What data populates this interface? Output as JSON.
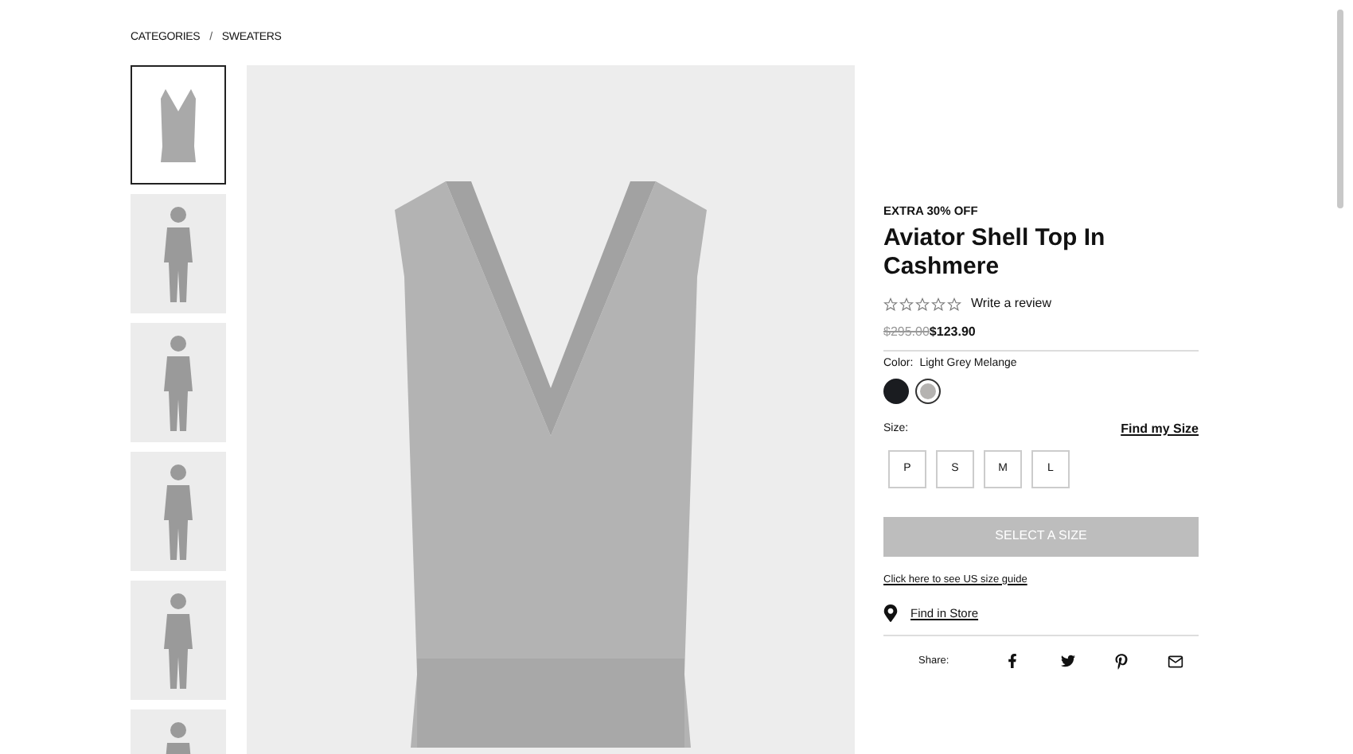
{
  "breadcrumb": [
    {
      "label": "CATEGORIES"
    },
    {
      "label": "SWEATERS"
    }
  ],
  "breadcrumb_separator": "/",
  "thumbnails": [
    {
      "selected": true,
      "kind": "product"
    },
    {
      "selected": false,
      "kind": "model"
    },
    {
      "selected": false,
      "kind": "model"
    },
    {
      "selected": false,
      "kind": "model"
    },
    {
      "selected": false,
      "kind": "model"
    },
    {
      "selected": false,
      "kind": "model"
    }
  ],
  "product": {
    "promo": "EXTRA 30% OFF",
    "title": "Aviator Shell Top In Cashmere",
    "stars": 0,
    "review_link": "Write a review",
    "original_price": "$295.00",
    "sale_price": "$123.90",
    "color_label": "Color:",
    "color_name": "Light Grey Melange",
    "swatches": [
      {
        "color": "#1a1c20",
        "selected": false
      },
      {
        "color": "#b5b3b1",
        "selected": true
      }
    ],
    "size_label": "Size:",
    "find_size": "Find my Size",
    "sizes": [
      {
        "label": "P",
        "selected": false
      },
      {
        "label": "S",
        "selected": false
      },
      {
        "label": "M",
        "selected": false
      },
      {
        "label": "L",
        "selected": false
      }
    ],
    "add_button": {
      "label": "SELECT A SIZE",
      "disabled": true
    },
    "size_guide": "Click here to see US size guide",
    "find_store": "Find in Store",
    "share_label": "Share:"
  }
}
